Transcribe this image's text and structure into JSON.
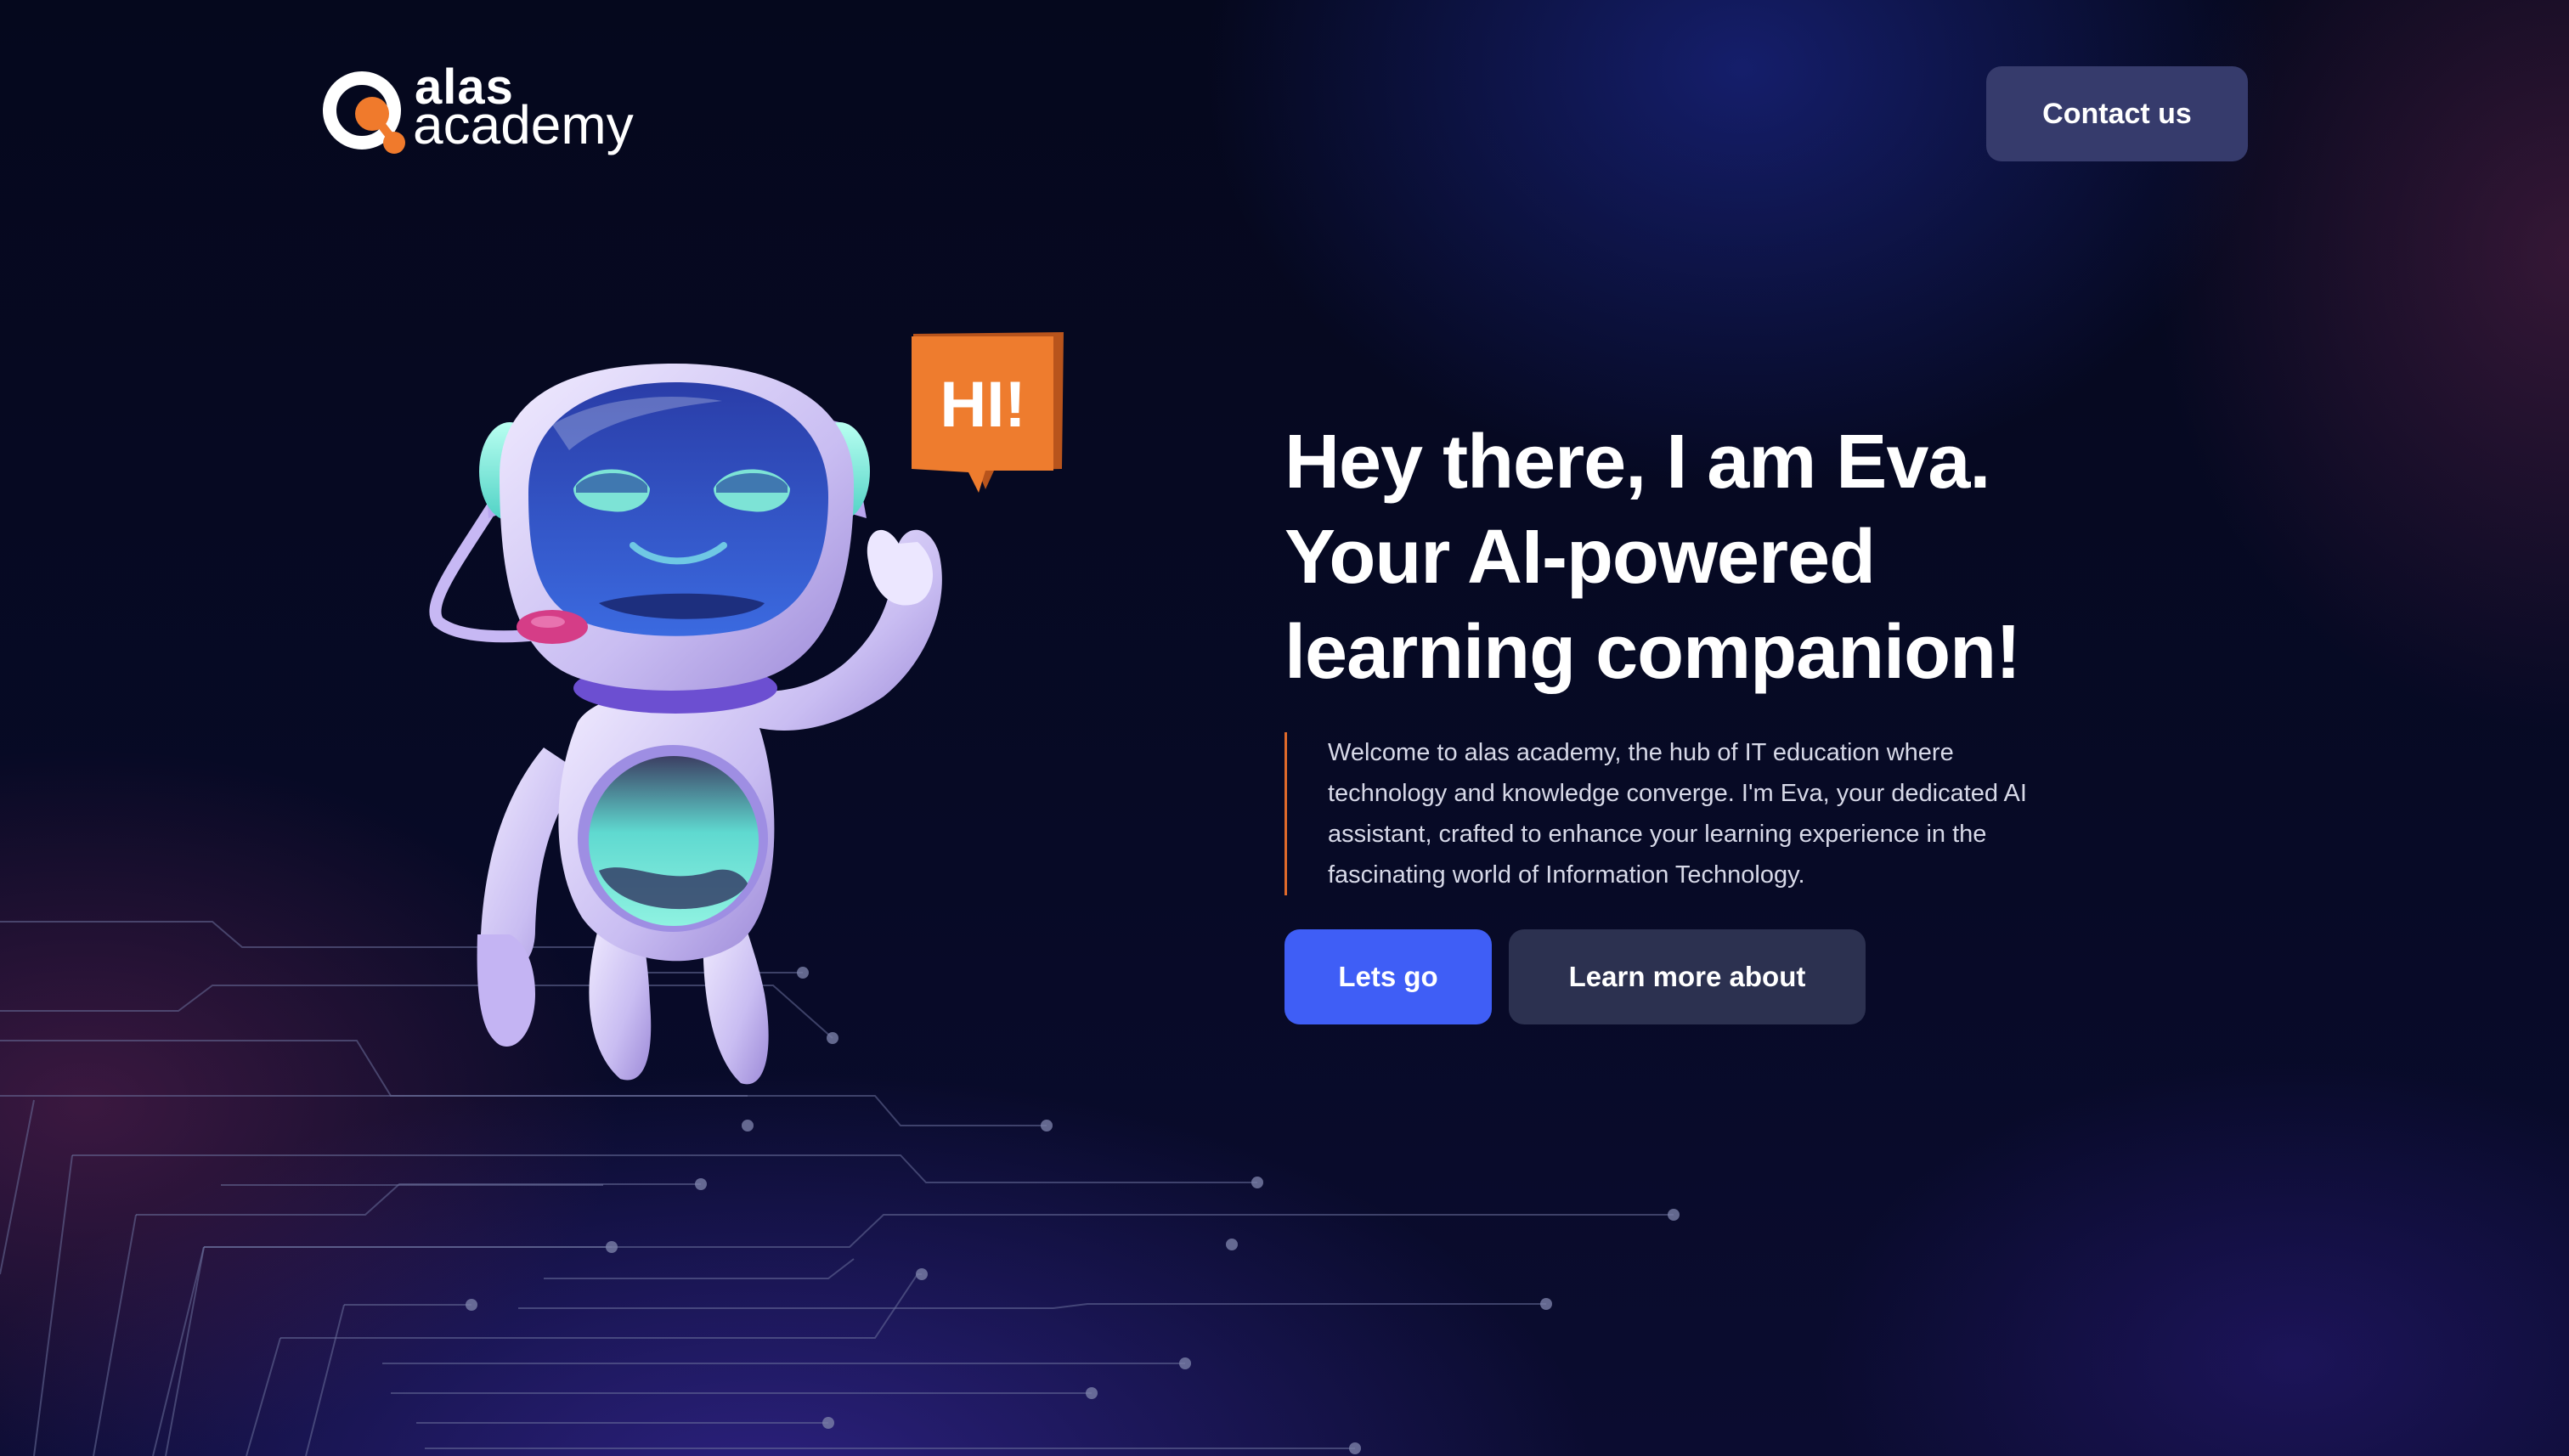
{
  "brand": {
    "name_line1": "alas",
    "name_line2": "academy",
    "accent_color": "#f07a2c"
  },
  "header": {
    "contact_label": "Contact us"
  },
  "mascot": {
    "speech_bubble_text": "HI!",
    "icon": "robot-mascot"
  },
  "hero": {
    "title_line1": "Hey there, I am Eva.",
    "title_line2": "Your AI-powered",
    "title_line3": "learning companion!",
    "intro_line1": "Welcome to alas academy, the hub of IT education where",
    "intro_line2": "technology and knowledge converge. I'm Eva, your dedicated AI",
    "intro_line3": "assistant, crafted to enhance your learning experience in the",
    "intro_line4": "fascinating world of Information Technology."
  },
  "actions": {
    "primary_label": "Lets go",
    "secondary_label": "Learn more about"
  },
  "colors": {
    "background": "#05081f",
    "primary_button": "#3f5ef6",
    "secondary_button": "#2c3150",
    "contact_button": "#363b6c",
    "intro_border": "#e06a2a"
  }
}
